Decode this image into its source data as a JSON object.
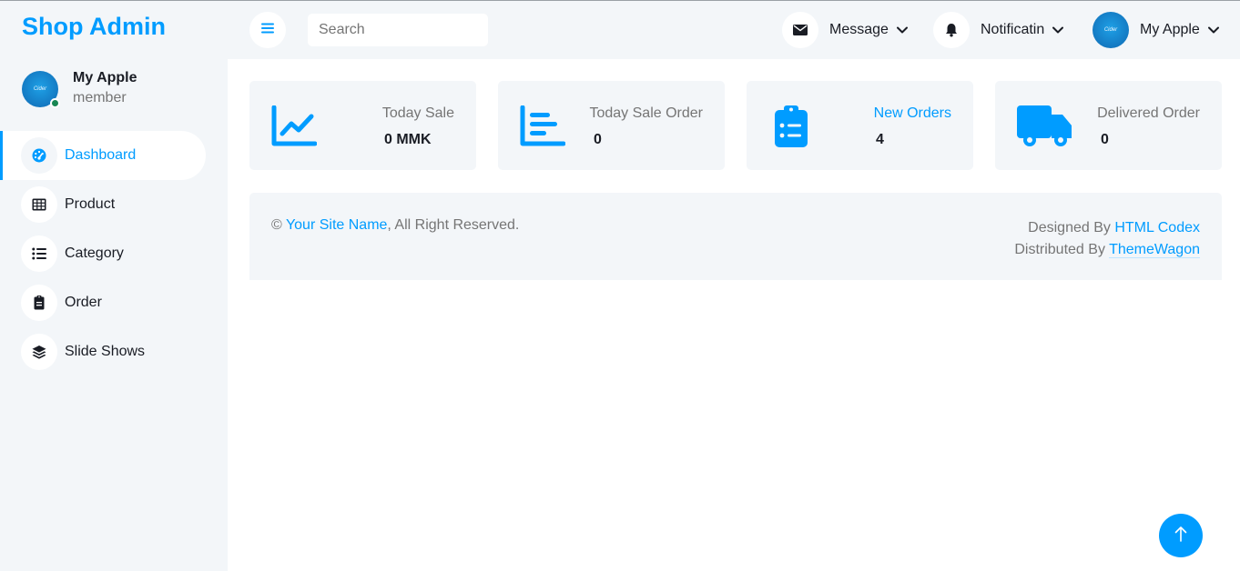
{
  "brand": "Shop Admin",
  "sidebar": {
    "user": {
      "name": "My Apple",
      "role": "member",
      "avatar_text": "Cider"
    },
    "items": [
      {
        "label": "Dashboard",
        "icon": "dashboard-icon",
        "active": true
      },
      {
        "label": "Product",
        "icon": "table-icon"
      },
      {
        "label": "Category",
        "icon": "list-icon"
      },
      {
        "label": "Order",
        "icon": "clipboard-icon"
      },
      {
        "label": "Slide Shows",
        "icon": "layers-icon"
      }
    ]
  },
  "topbar": {
    "search_placeholder": "Search",
    "message_label": "Message",
    "notification_label": "Notificatin",
    "profile_label": "My Apple"
  },
  "cards": [
    {
      "title": "Today Sale",
      "value": "0 MMK",
      "icon": "line-chart-icon"
    },
    {
      "title": "Today Sale Order",
      "value": "0",
      "icon": "bar-chart-icon"
    },
    {
      "title": "New Orders",
      "value": "4",
      "icon": "clipboard-list-icon",
      "title_color": "#009cff"
    },
    {
      "title": "Delivered Order",
      "value": "0",
      "icon": "truck-icon"
    }
  ],
  "footer": {
    "copyright_symbol": "©",
    "site_name": "Your Site Name",
    "rights": ", All Right Reserved.",
    "designed_by": "Designed By",
    "designer": "HTML Codex",
    "distributed_by": "Distributed By",
    "distributor": "ThemeWagon"
  },
  "colors": {
    "primary": "#009cff",
    "light": "#f3f6f9",
    "dark": "#191c24",
    "muted": "#757575",
    "online": "#198754"
  }
}
